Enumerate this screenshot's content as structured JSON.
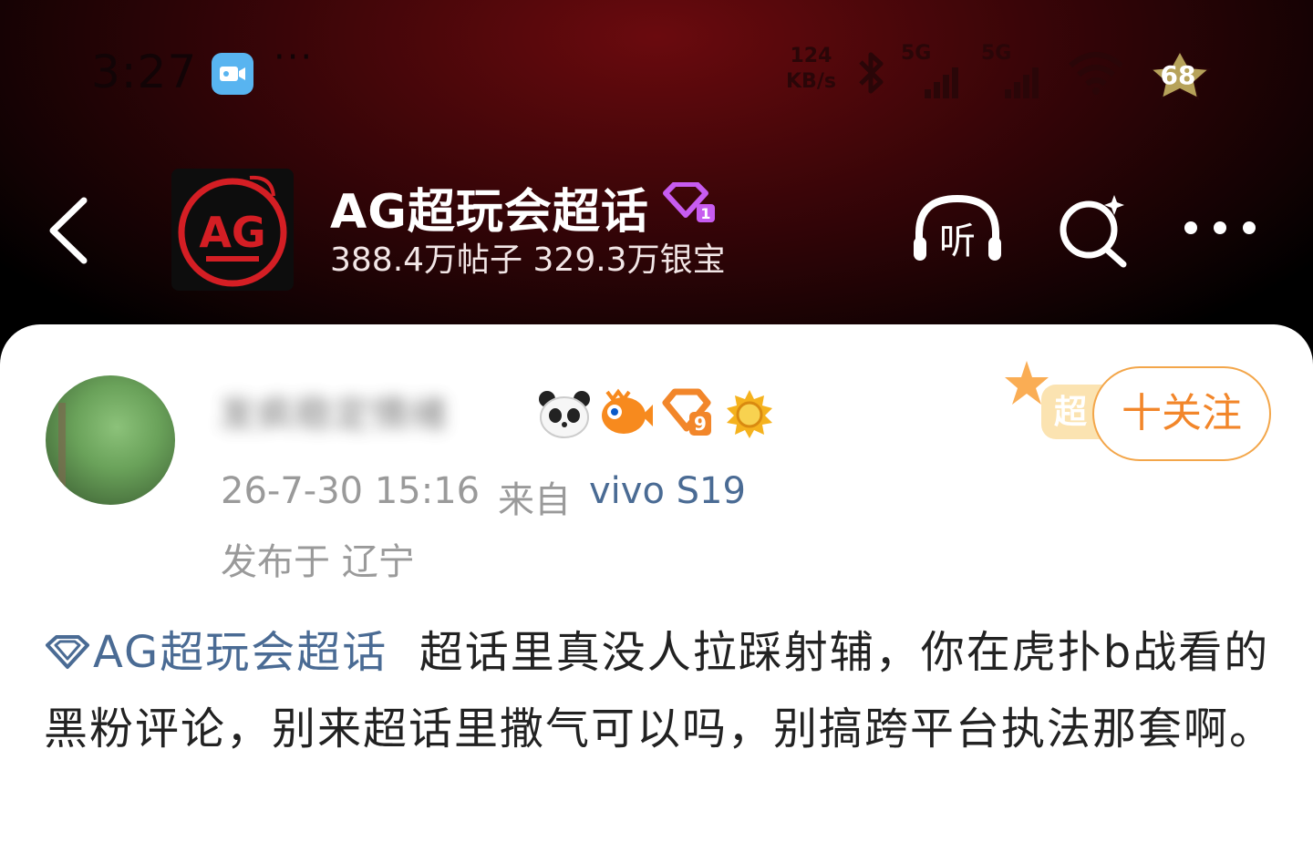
{
  "status_bar": {
    "time": "3:27",
    "net_speed_value": "124",
    "net_speed_unit": "KB/s",
    "signal_1_label": "5G",
    "signal_2_label": "5G",
    "battery_level": "68"
  },
  "header": {
    "title": "AG超玩会超话",
    "stats": "388.4万帖子 329.3万银宝",
    "logo_text": "AG",
    "listen_label": "听"
  },
  "post": {
    "username": "发疯稳定情绪",
    "timestamp": "26-7-30 15:16",
    "source_prefix": "来自",
    "device": "vivo S19",
    "location": "发布于 辽宁",
    "follow_label": "十关注",
    "promo_label": "超",
    "topic": "AG超玩会超话",
    "content": "超话里真没人拉踩射辅，你在虎扑b战看的黑粉评论，别来超话里撒气可以吗，别搞跨平台执法那套啊。",
    "badge_level": "9"
  },
  "colors": {
    "accent_orange": "#f2862a",
    "link_blue": "#4a6b94",
    "header_bg": "#3a0508"
  }
}
